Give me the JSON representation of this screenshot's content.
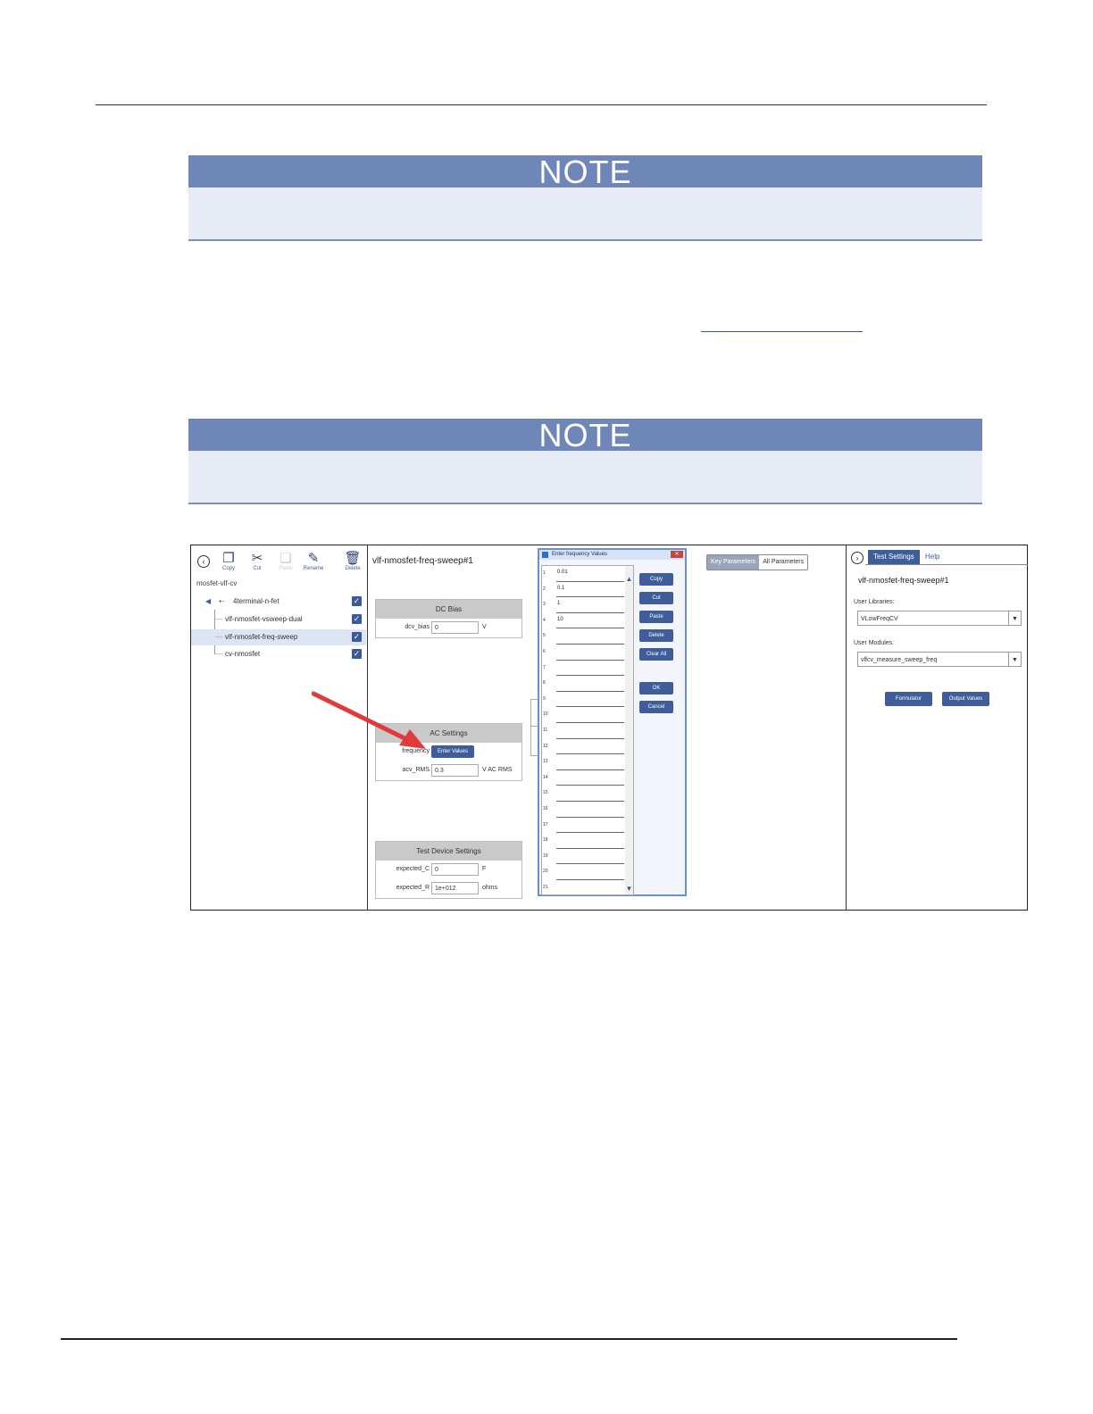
{
  "notes": [
    {
      "heading": "NOTE"
    },
    {
      "heading": "NOTE"
    }
  ],
  "screenshot": {
    "toolbar": {
      "copy": "Copy",
      "cut": "Cut",
      "paste": "Paste",
      "rename": "Rename",
      "delete": "Delete"
    },
    "project_name": "mosfet-vlf-cv",
    "tree": [
      {
        "label": "4terminal-n-fet"
      },
      {
        "label": "vlf-nmosfet-vsweep-dual"
      },
      {
        "label": "vlf-nmosfet-freq-sweep"
      },
      {
        "label": "cv-nmosfet"
      }
    ],
    "test_title": "vlf-nmosfet-freq-sweep#1",
    "dc_bias": {
      "header": "DC Bias",
      "label": "dcv_bias",
      "value": "0",
      "unit": "V"
    },
    "ac_settings": {
      "header": "AC Settings",
      "freq_label": "frequency",
      "enter_values": "Enter Values",
      "rms_label": "acv_RMS",
      "rms_value": "0.3",
      "rms_unit": "V AC RMS"
    },
    "device_settings": {
      "header": "Test Device Settings",
      "c_label": "expected_C",
      "c_value": "0",
      "c_unit": "F",
      "r_label": "expected_R",
      "r_value": "1e+012",
      "r_unit": "ohms"
    },
    "dialog": {
      "title": "Enter frequency Values",
      "close": "✕",
      "rows": [
        {
          "n": "1",
          "v": "0.01"
        },
        {
          "n": "2",
          "v": "0.1"
        },
        {
          "n": "3",
          "v": "1"
        },
        {
          "n": "4",
          "v": "10"
        },
        {
          "n": "5",
          "v": ""
        },
        {
          "n": "6",
          "v": ""
        },
        {
          "n": "7",
          "v": ""
        },
        {
          "n": "8",
          "v": ""
        },
        {
          "n": "9",
          "v": ""
        },
        {
          "n": "10",
          "v": ""
        },
        {
          "n": "11",
          "v": ""
        },
        {
          "n": "12",
          "v": ""
        },
        {
          "n": "13",
          "v": ""
        },
        {
          "n": "14",
          "v": ""
        },
        {
          "n": "15",
          "v": ""
        },
        {
          "n": "16",
          "v": ""
        },
        {
          "n": "17",
          "v": ""
        },
        {
          "n": "18",
          "v": ""
        },
        {
          "n": "19",
          "v": ""
        },
        {
          "n": "20",
          "v": ""
        },
        {
          "n": "21",
          "v": ""
        }
      ],
      "buttons": {
        "copy": "Copy",
        "cut": "Cut",
        "paste": "Paste",
        "delete": "Delete",
        "clear_all": "Clear All",
        "ok": "OK",
        "cancel": "Cancel"
      }
    },
    "param_tabs": {
      "key": "Key Parameters",
      "all": "All Parameters"
    },
    "right_panel": {
      "tab_settings": "Test Settings",
      "tab_help": "Help",
      "title": "vlf-nmosfet-freq-sweep#1",
      "lib_label": "User Libraries:",
      "lib_value": "VLowFreqCV",
      "mod_label": "User Modules:",
      "mod_value": "vlfcv_measure_sweep_freq",
      "formulator": "Formulator",
      "output_values": "Output Values"
    },
    "colors": {
      "accent": "#3f5c9b",
      "note_header": "#6f86b8",
      "note_body": "#e7ebf5",
      "arrow": "#e03a3a"
    }
  }
}
